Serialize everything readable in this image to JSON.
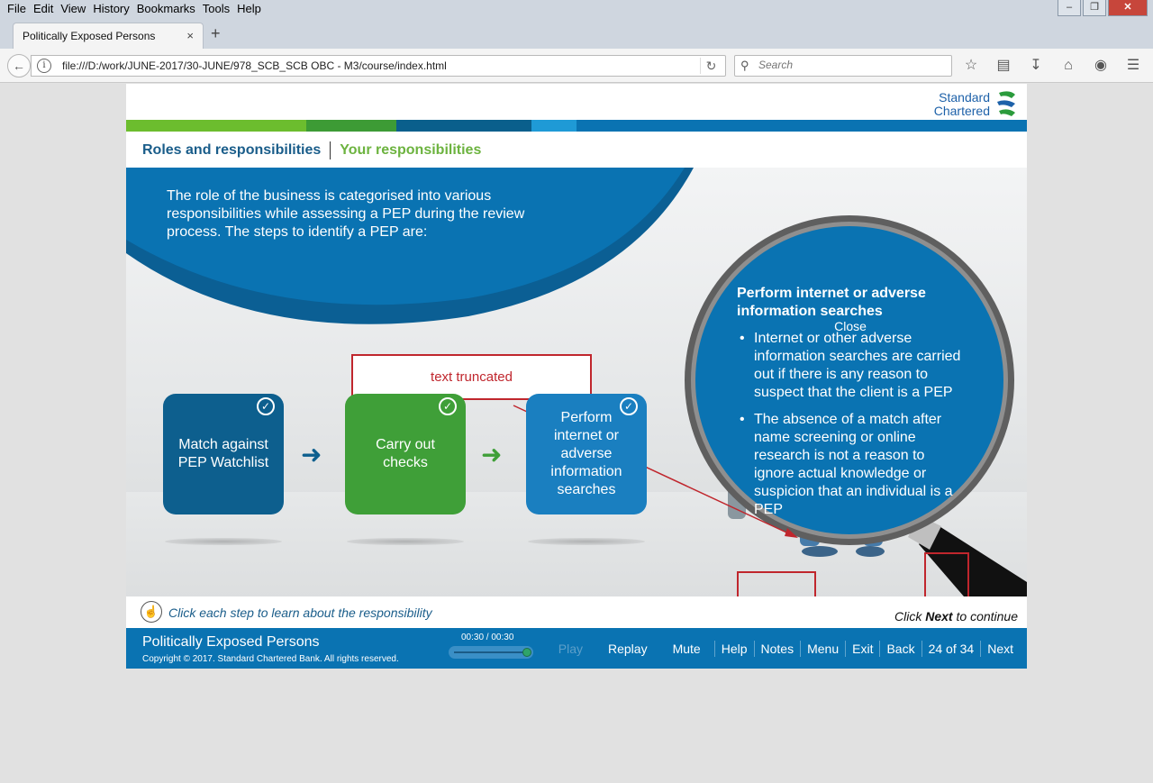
{
  "browser": {
    "menu": [
      "File",
      "Edit",
      "View",
      "History",
      "Bookmarks",
      "Tools",
      "Help"
    ],
    "window_controls": [
      "minimize",
      "restore",
      "close"
    ],
    "tab": {
      "title": "Politically Exposed Persons",
      "close": "×"
    },
    "new_tab": "+",
    "url": "file:///D:/work/JUNE-2017/30-JUNE/978_SCB_SCB OBC - M3/course/index.html",
    "search_placeholder": "Search",
    "toolbar_icons": [
      "bookmark-star-icon",
      "reading-list-icon",
      "download-icon",
      "home-icon",
      "pocket-icon",
      "hamburger-menu-icon"
    ]
  },
  "course": {
    "logo": {
      "line1": "Standard",
      "line2": "Chartered"
    },
    "stripe_colors": [
      "#6cbd2e",
      "#3d9b35",
      "#0a5f8c",
      "#1f9ad6",
      "#0a73b2"
    ],
    "breadcrumb": {
      "section": "Roles and responsibilities",
      "page": "Your responsibilities"
    },
    "intro": "The role of the business is categorised into various responsibilities while assessing a PEP during the review process. The steps to identify a PEP are:",
    "annotation": "text truncated",
    "steps": [
      {
        "label": "Match against PEP Watchlist",
        "color": "#0d5f8e"
      },
      {
        "label": "Carry out checks",
        "color": "#3f9f38"
      },
      {
        "label": "Perform internet or adverse information searches",
        "color": "#1a7fc0"
      }
    ],
    "magnifier": {
      "close": "Close",
      "title": "Perform internet or adverse information searches",
      "bullets": [
        "Internet or other adverse information searches are carried out if there is any reason to suspect that the client is a PEP",
        "The absence of a match after name screening or online research is not a reason to ignore actual knowledge or suspicion that an individual is a PEP"
      ]
    },
    "hint": "Click each step to learn about the responsibility",
    "continue": {
      "pre": "Click ",
      "bold": "Next",
      "post": " to continue"
    },
    "footer": {
      "title": "Politically Exposed Persons",
      "copyright": "Copyright © 2017. Standard Chartered Bank. All rights reserved.",
      "time": "00:30 / 00:30",
      "progress": 1.0,
      "nav": [
        "Play",
        "Replay",
        "Mute",
        "Help",
        "Notes",
        "Menu",
        "Exit",
        "Back"
      ],
      "page_counter": "24 of 34",
      "next": "Next"
    }
  }
}
